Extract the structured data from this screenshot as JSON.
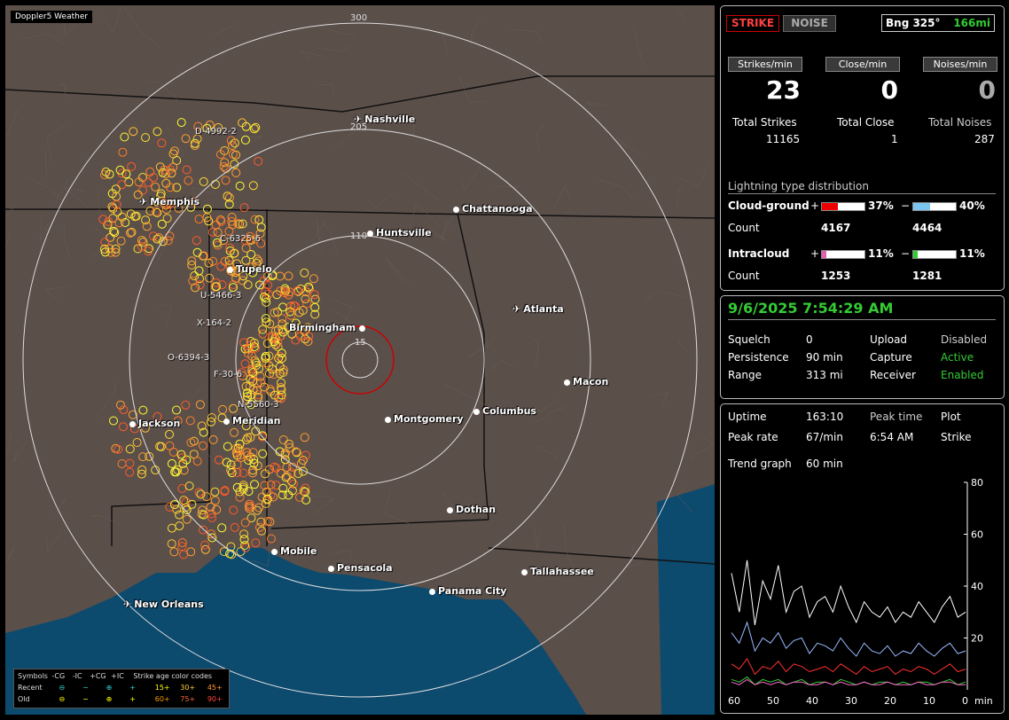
{
  "app_title": "Doppler5 Weather",
  "map": {
    "ring_labels": [
      "300",
      "205",
      "110",
      "15"
    ],
    "cities": [
      {
        "name": "Nashville",
        "kind": "airport"
      },
      {
        "name": "Memphis",
        "kind": "airport"
      },
      {
        "name": "Chattanooga",
        "kind": "city"
      },
      {
        "name": "Huntsville",
        "kind": "city"
      },
      {
        "name": "Tupelo",
        "kind": "city"
      },
      {
        "name": "Atlanta",
        "kind": "airport"
      },
      {
        "name": "Birmingham",
        "kind": "city"
      },
      {
        "name": "Macon",
        "kind": "city"
      },
      {
        "name": "Jackson",
        "kind": "city"
      },
      {
        "name": "Meridian",
        "kind": "city"
      },
      {
        "name": "Montgomery",
        "kind": "city"
      },
      {
        "name": "Columbus",
        "kind": "city"
      },
      {
        "name": "Dothan",
        "kind": "city"
      },
      {
        "name": "Mobile",
        "kind": "city"
      },
      {
        "name": "Pensacola",
        "kind": "city"
      },
      {
        "name": "Tallahassee",
        "kind": "city"
      },
      {
        "name": "Panama City",
        "kind": "city"
      },
      {
        "name": "New Orleans",
        "kind": "airport"
      }
    ],
    "storm_labels": [
      "D-4992-2",
      "C-6325-6",
      "U-5466-3",
      "X-164-2",
      "O-6394-3",
      "F-30-6",
      "N-5560-3"
    ],
    "colors": {
      "land": "#5b4f4a",
      "water": "#0c4a6e",
      "ring": "#dddddd",
      "close_ring": "#cc0000"
    }
  },
  "legend": {
    "symbols_label": "Symbols",
    "cols": [
      "-CG",
      "-IC",
      "+CG",
      "+IC"
    ],
    "recent_label": "Recent",
    "old_label": "Old",
    "age_title": "Strike age color codes",
    "ages_recent": [
      "15+",
      "30+",
      "45+"
    ],
    "ages_old": [
      "60+",
      "75+",
      "90+"
    ]
  },
  "stats": {
    "strike_button": "STRIKE",
    "noise_button": "NOISE",
    "bearing": "Bng 325°",
    "distance": "166mi",
    "headers": [
      "Strikes/min",
      "Close/min",
      "Noises/min"
    ],
    "rates": [
      "23",
      "0",
      "0"
    ],
    "total_labels": [
      "Total Strikes",
      "Total Close",
      "Total Noises"
    ],
    "totals": [
      "11165",
      "1",
      "287"
    ],
    "distribution_title": "Lightning type distribution",
    "cloud_ground_label": "Cloud-ground",
    "intracloud_label": "Intracloud",
    "count_label": "Count",
    "plus": "+",
    "minus": "−",
    "cg_pos_pct": "37%",
    "cg_neg_pct": "40%",
    "cg_pos_count": "4167",
    "cg_neg_count": "4464",
    "ic_pos_pct": "11%",
    "ic_neg_pct": "11%",
    "ic_pos_count": "1253",
    "ic_neg_count": "1281",
    "cg_pos_fraction": 0.37,
    "cg_neg_fraction": 0.4,
    "ic_pos_fraction": 0.11,
    "ic_neg_fraction": 0.11
  },
  "status": {
    "datetime": "9/6/2025 7:54:29 AM",
    "squelch_label": "Squelch",
    "squelch": "0",
    "persistence_label": "Persistence",
    "persistence": "90 min",
    "range_label": "Range",
    "range": "313 mi",
    "upload_label": "Upload",
    "upload": "Disabled",
    "capture_label": "Capture",
    "capture": "Active",
    "receiver_label": "Receiver",
    "receiver": "Enabled"
  },
  "trend": {
    "uptime_label": "Uptime",
    "uptime": "163:10",
    "peak_time_label": "Peak time",
    "peak_time": "6:54 AM",
    "plot_label": "Plot",
    "plot": "Strike",
    "peak_rate_label": "Peak rate",
    "peak_rate": "67/min",
    "graph_label": "Trend graph",
    "graph_window": "60 min",
    "y_ticks": [
      "80",
      "60",
      "40",
      "20"
    ],
    "x_ticks": [
      "60",
      "50",
      "40",
      "30",
      "20",
      "10",
      "0"
    ],
    "x_unit": "min"
  },
  "chart_data": {
    "type": "line",
    "x": [
      60,
      58,
      56,
      54,
      52,
      50,
      48,
      46,
      44,
      42,
      40,
      38,
      36,
      34,
      32,
      30,
      28,
      26,
      24,
      22,
      20,
      18,
      16,
      14,
      12,
      10,
      8,
      6,
      4,
      2,
      0
    ],
    "ylim": [
      0,
      80
    ],
    "series": [
      {
        "color": "#ffffff",
        "values": [
          45,
          30,
          50,
          25,
          42,
          35,
          48,
          30,
          38,
          40,
          28,
          34,
          36,
          30,
          40,
          32,
          26,
          34,
          30,
          28,
          32,
          26,
          30,
          28,
          34,
          30,
          26,
          32,
          36,
          28,
          30
        ]
      },
      {
        "color": "#99bbff",
        "values": [
          22,
          18,
          26,
          15,
          20,
          18,
          22,
          16,
          19,
          20,
          14,
          18,
          17,
          15,
          20,
          16,
          13,
          18,
          15,
          14,
          17,
          13,
          15,
          14,
          18,
          15,
          13,
          16,
          18,
          14,
          15
        ]
      },
      {
        "color": "#ff3030",
        "values": [
          10,
          8,
          12,
          6,
          9,
          8,
          11,
          7,
          10,
          9,
          7,
          8,
          9,
          7,
          10,
          8,
          6,
          9,
          7,
          8,
          9,
          6,
          8,
          7,
          9,
          8,
          6,
          8,
          10,
          7,
          8
        ]
      },
      {
        "color": "#33cc33",
        "values": [
          4,
          3,
          5,
          2,
          4,
          3,
          4,
          2,
          3,
          4,
          2,
          3,
          3,
          2,
          4,
          3,
          2,
          3,
          2,
          3,
          3,
          2,
          3,
          2,
          3,
          3,
          2,
          3,
          4,
          2,
          3
        ]
      },
      {
        "color": "#ff66cc",
        "values": [
          3,
          2,
          4,
          2,
          3,
          2,
          3,
          2,
          3,
          3,
          2,
          2,
          3,
          2,
          3,
          2,
          2,
          3,
          2,
          2,
          3,
          2,
          2,
          2,
          3,
          2,
          2,
          3,
          3,
          2,
          2
        ]
      }
    ]
  }
}
